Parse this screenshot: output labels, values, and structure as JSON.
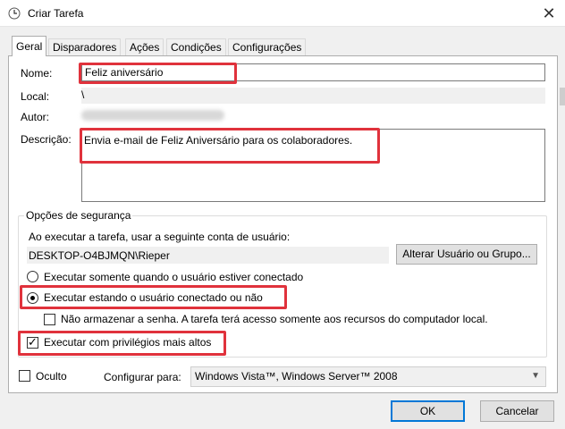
{
  "window": {
    "title": "Criar Tarefa",
    "close_symbol": "✕"
  },
  "tabs": [
    {
      "label": "Geral",
      "active": true
    },
    {
      "label": "Disparadores"
    },
    {
      "label": "Ações"
    },
    {
      "label": "Condições"
    },
    {
      "label": "Configurações"
    }
  ],
  "form": {
    "name_label": "Nome:",
    "name_value": "Feliz aniversário",
    "location_label": "Local:",
    "location_value": "\\",
    "author_label": "Autor:",
    "description_label": "Descrição:",
    "description_value": "Envia e-mail de Feliz Aniversário para os colaboradores."
  },
  "security": {
    "group_title": "Opções de segurança",
    "run_as_text": "Ao executar a tarefa, usar a seguinte conta de usuário:",
    "user_account": "DESKTOP-O4BJMQN\\Rieper",
    "change_user_button": "Alterar Usuário ou Grupo...",
    "radio_logged_on": "Executar somente quando o usuário estiver conectado",
    "radio_whether": "Executar estando o usuário conectado ou não",
    "radio_selected": "whether",
    "no_store_password": "Não armazenar a senha. A tarefa terá acesso somente aos recursos do computador local.",
    "no_store_password_checked": false,
    "highest_privileges": "Executar com privilégios mais altos",
    "highest_privileges_checked": true
  },
  "bottom": {
    "hidden_label": "Oculto",
    "hidden_checked": false,
    "configure_label": "Configurar para:",
    "configure_value": "Windows Vista™, Windows Server™ 2008"
  },
  "buttons": {
    "ok": "OK",
    "cancel": "Cancelar"
  },
  "colors": {
    "highlight": "#e0323c",
    "accent": "#0078d7"
  }
}
